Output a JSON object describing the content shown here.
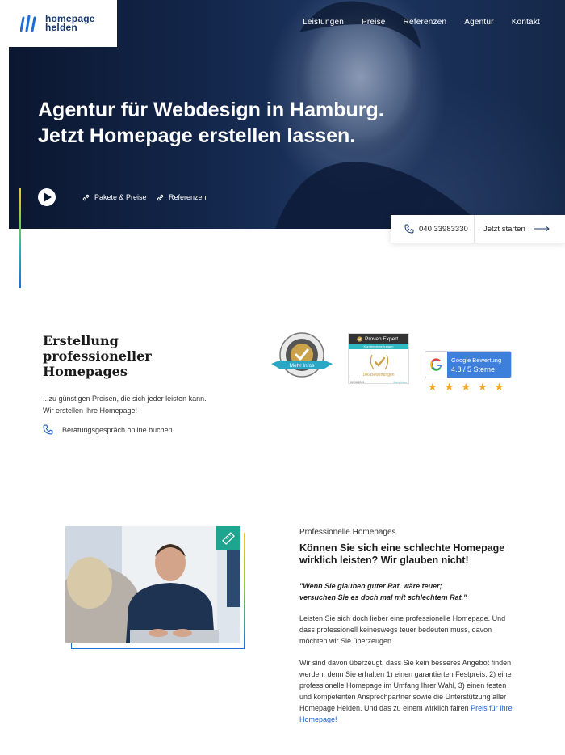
{
  "header": {
    "logo": {
      "line1": "homepage",
      "line2": "helden"
    },
    "nav": [
      "Leistungen",
      "Preise",
      "Referenzen",
      "Agentur",
      "Kontakt"
    ]
  },
  "hero": {
    "title_line1": "Agentur für Webdesign in Hamburg.",
    "title_line2": "Jetzt Homepage erstellen lassen.",
    "links": [
      "Pakete & Preise",
      "Referenzen"
    ]
  },
  "cta": {
    "phone": "040 33983330",
    "start": "Jetzt starten"
  },
  "intro": {
    "heading": [
      "Erstellung",
      "professioneller",
      "Homepages"
    ],
    "text": [
      "...zu günstigen Preisen, die sich jeder leisten kann.",
      "Wir erstellen Ihre Homepage!"
    ],
    "consult": "Beratungsgespräch online buchen"
  },
  "badges": {
    "seal_ribbon": "Mehr Infos",
    "seal_ring": "PROVEN EXPERT",
    "pe_brand": "Proven Expert",
    "pe_band": "Kundenbewertungen",
    "pe_count": "106 Bewertungen",
    "pe_date": "02.08.2021",
    "pe_more": "Mehr Infos",
    "google_label": "Google Bewertung",
    "google_rating": "4.8 / 5 Sterne",
    "stars_filled": 5,
    "stars_total": 5
  },
  "about": {
    "kicker": "Professionelle Homepages",
    "heading": [
      "Können Sie sich eine schlechte Homepage",
      "wirklich leisten? Wir glauben nicht!"
    ],
    "quote": [
      "\"Wenn Sie glauben guter Rat, wäre teuer;",
      "versuchen Sie es doch mal mit schlechtem Rat.\""
    ],
    "p1": [
      "Leisten Sie sich doch lieber eine professionelle Homepage. Und",
      "dass professionell keineswegs teuer bedeuten muss, davon",
      "möchten wir Sie überzeugen."
    ],
    "p2": [
      "Wir sind davon überzeugt, dass Sie kein besseres Angebot finden",
      "werden, denn Sie erhalten 1) einen garantierten Festpreis, 2) eine",
      "professionelle Homepage im Umfang Ihrer Wahl, 3) einen festen",
      "und kompetenten Ansprechpartner sowie die Unterstützung aller"
    ],
    "p2_last_prefix": "Homepage Helden. Und das zu einem wirklich fairen ",
    "p2_link_part1": "Preis für Ihre",
    "p2_link_part2": "Homepage!"
  },
  "colors": {
    "brand_blue": "#17366e",
    "link_blue": "#1d5fc4",
    "teal": "#1ea58f",
    "google_blue": "#3e7fdc",
    "star": "#f5a623"
  }
}
